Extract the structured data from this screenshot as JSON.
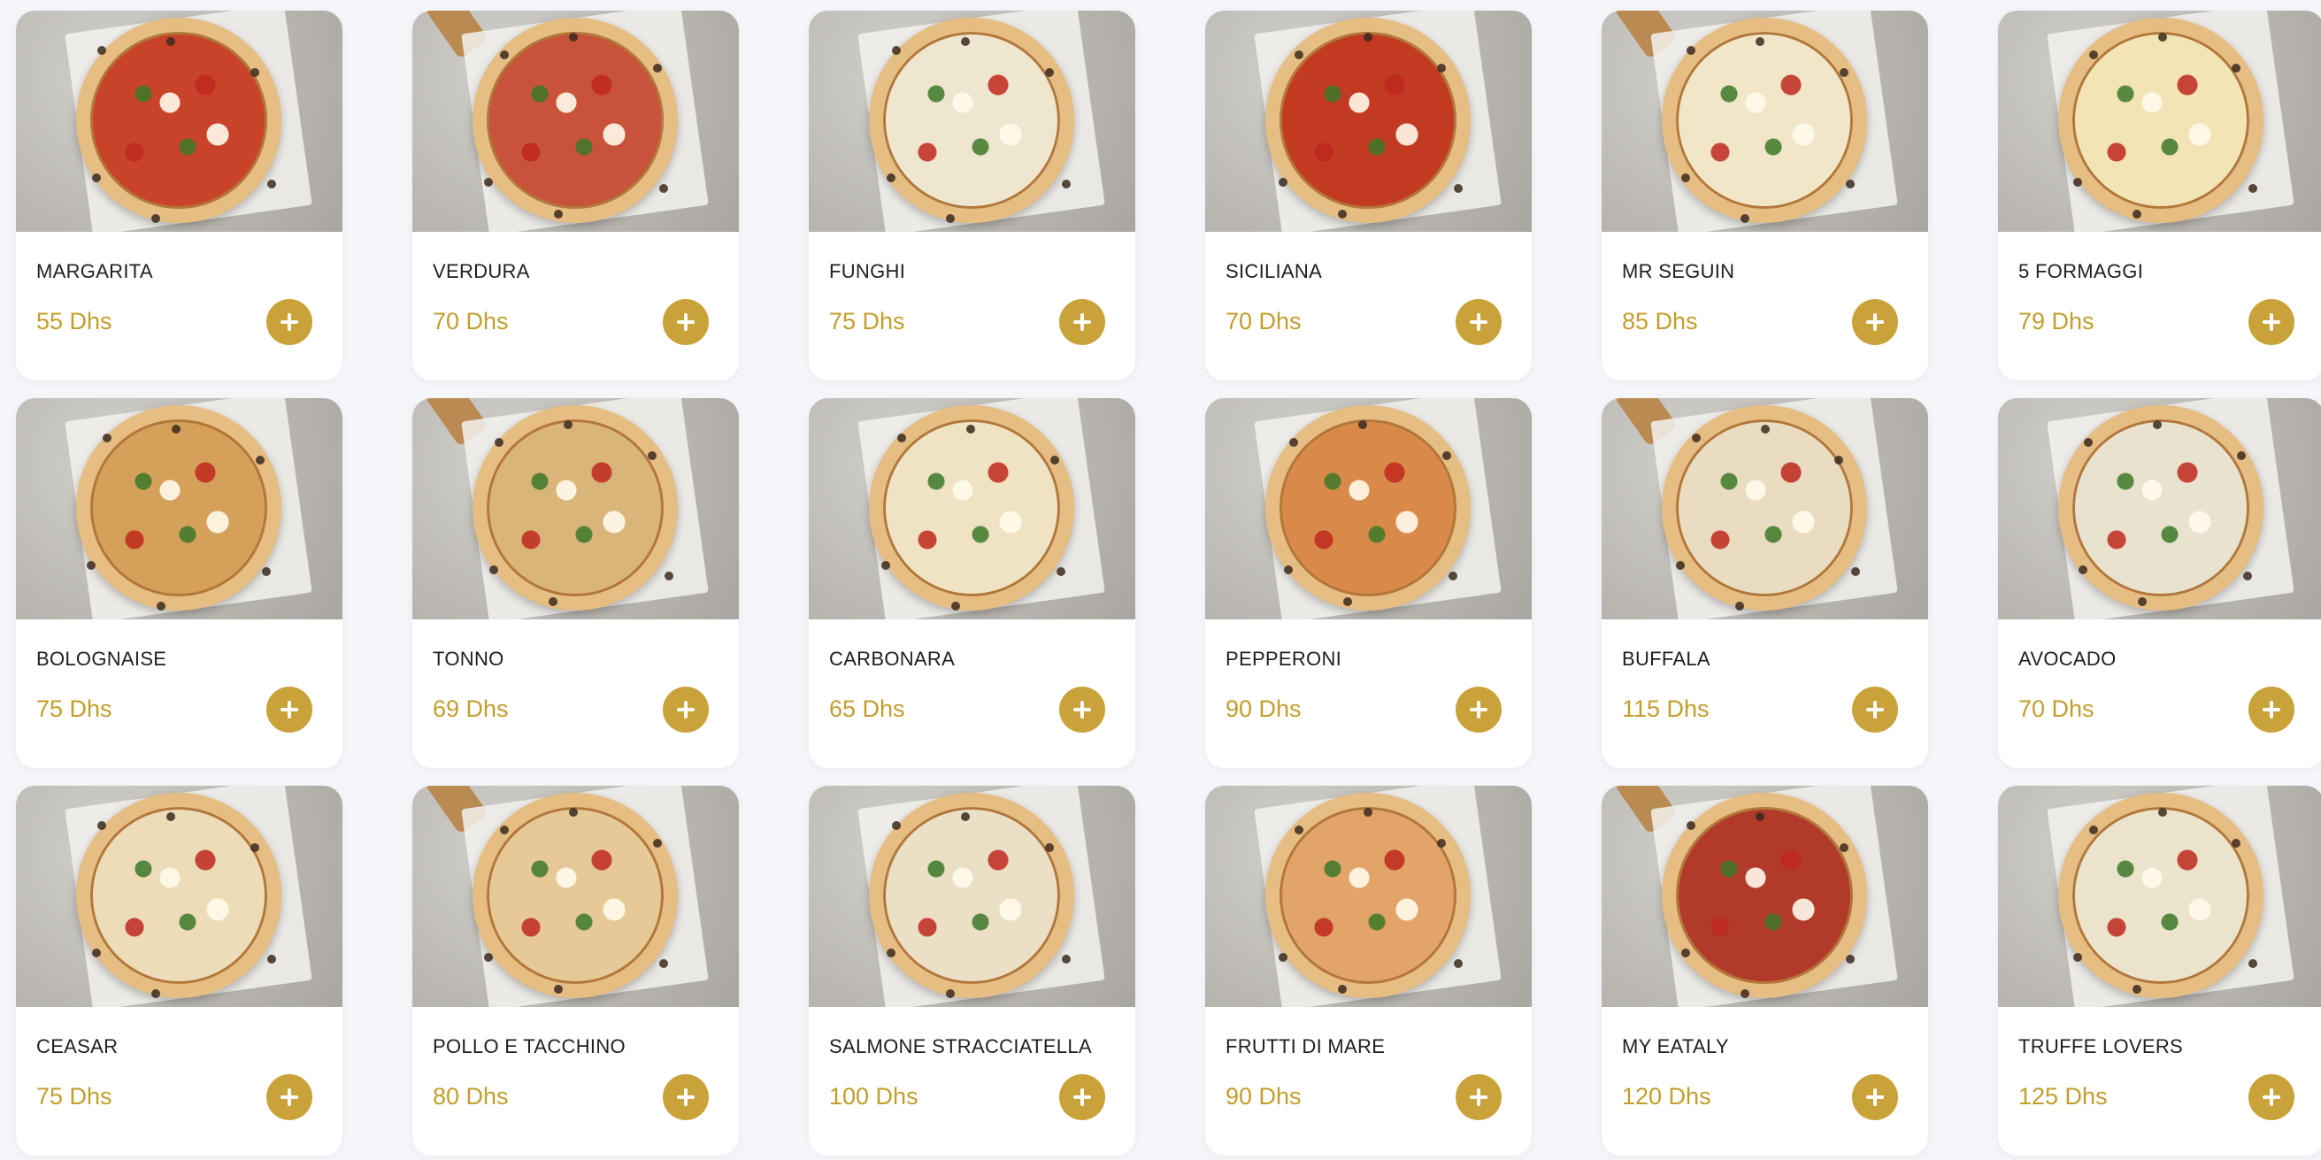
{
  "colors": {
    "accent": "#c9a23a",
    "price": "#c29e2b",
    "background": "#f5f6fa",
    "card": "#ffffff"
  },
  "add_icon": "plus-icon",
  "products": [
    {
      "name": "MARGARITA",
      "price": "55 Dhs",
      "sauce": "#c8432a"
    },
    {
      "name": "VERDURA",
      "price": "70 Dhs",
      "sauce": "#c8533a"
    },
    {
      "name": "FUNGHI",
      "price": "75 Dhs",
      "sauce": "#efe6cf"
    },
    {
      "name": "SICILIANA",
      "price": "70 Dhs",
      "sauce": "#c23a22"
    },
    {
      "name": "MR SEGUIN",
      "price": "85 Dhs",
      "sauce": "#f1e7c8"
    },
    {
      "name": "5 FORMAGGI",
      "price": "79 Dhs",
      "sauce": "#f3e4b5"
    },
    {
      "name": "BOLOGNAISE",
      "price": "75 Dhs",
      "sauce": "#d5a05a"
    },
    {
      "name": "TONNO",
      "price": "69 Dhs",
      "sauce": "#d9b57a"
    },
    {
      "name": "CARBONARA",
      "price": "65 Dhs",
      "sauce": "#efe3c3"
    },
    {
      "name": "PEPPERONI",
      "price": "90 Dhs",
      "sauce": "#d98a4a"
    },
    {
      "name": "BUFFALA",
      "price": "115 Dhs",
      "sauce": "#e9dcc0"
    },
    {
      "name": "AVOCADO",
      "price": "70 Dhs",
      "sauce": "#e8e2cf"
    },
    {
      "name": "CEASAR",
      "price": "75 Dhs",
      "sauce": "#ecdcb8"
    },
    {
      "name": "POLLO E TACCHINO",
      "price": "80 Dhs",
      "sauce": "#e6c996"
    },
    {
      "name": "SALMONE STRACCIATELLA",
      "price": "100 Dhs",
      "sauce": "#ebdfc6"
    },
    {
      "name": "FRUTTI DI MARE",
      "price": "90 Dhs",
      "sauce": "#e3a469"
    },
    {
      "name": "MY EATALY",
      "price": "120 Dhs",
      "sauce": "#b23a2a"
    },
    {
      "name": "TRUFFE LOVERS",
      "price": "125 Dhs",
      "sauce": "#ece3cc"
    }
  ]
}
